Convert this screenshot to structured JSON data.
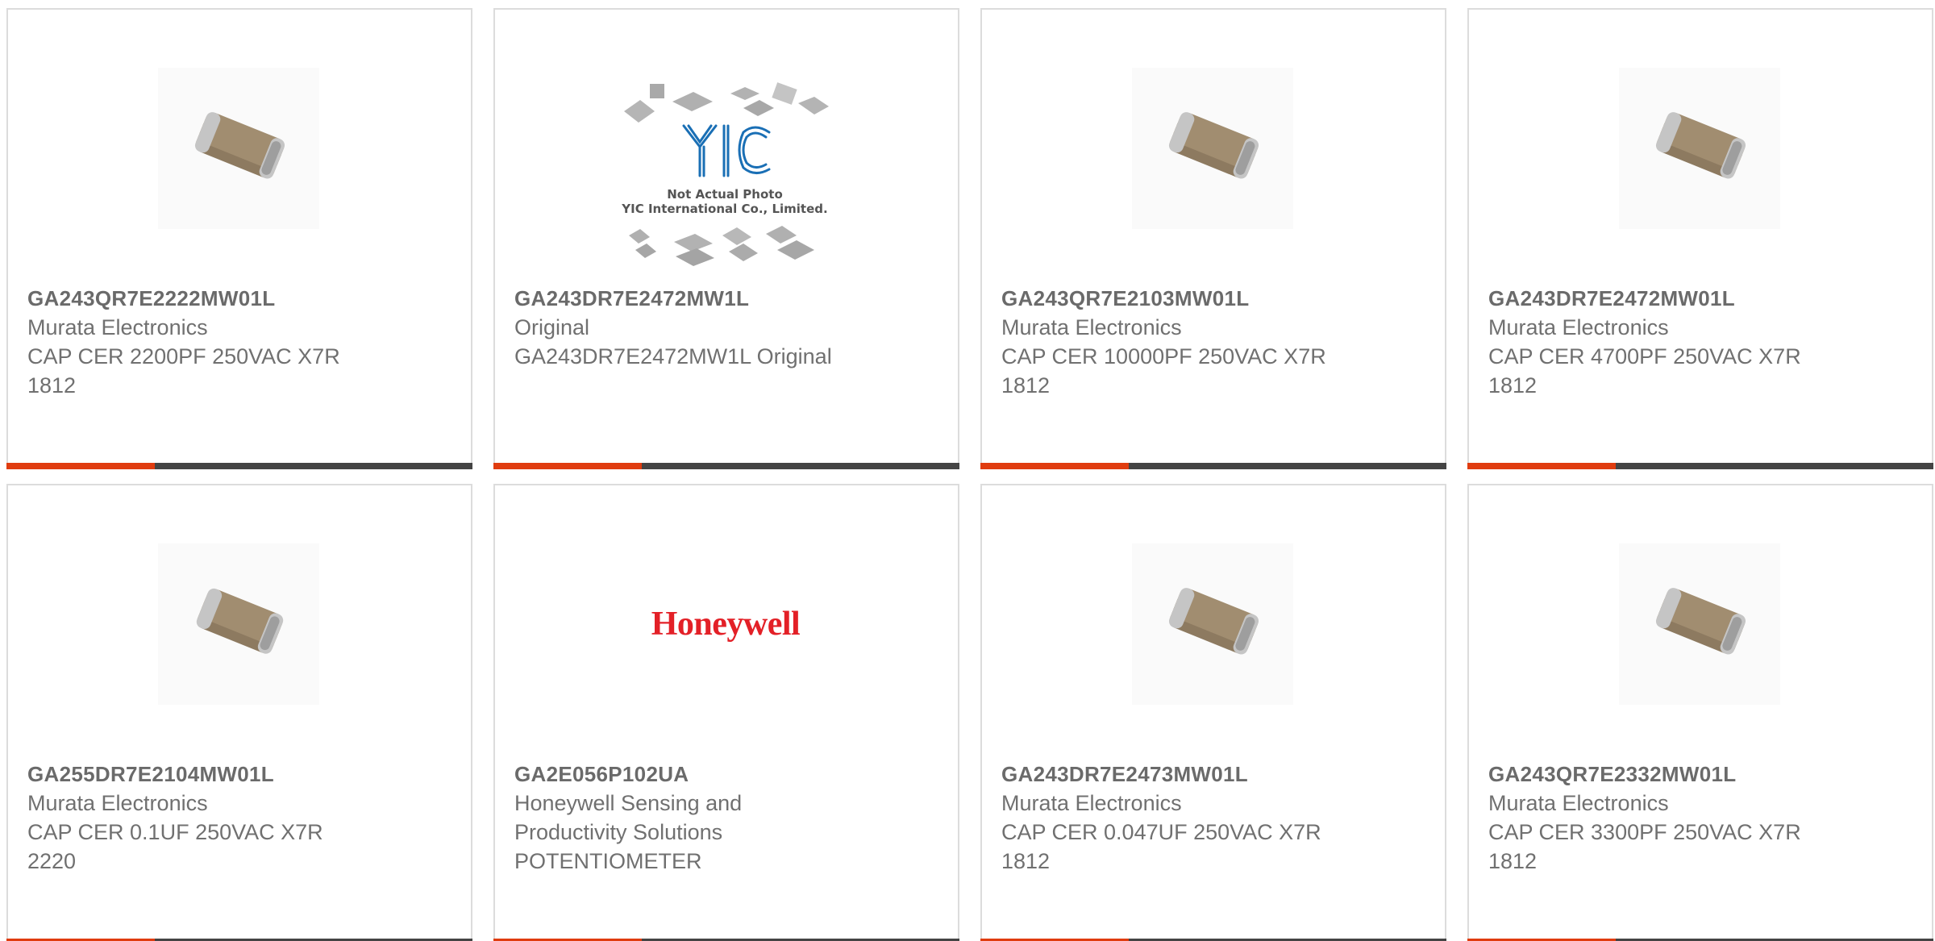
{
  "products": [
    {
      "part_number": "GA243QR7E2222MW01L",
      "manufacturer": "Murata Electronics",
      "description": "CAP CER 2200PF 250VAC X7R 1812",
      "image": "capacitor-chip"
    },
    {
      "part_number": "GA243DR7E2472MW1L",
      "manufacturer": "Original",
      "description": "GA243DR7E2472MW1L Original",
      "image": "yic-placeholder",
      "image_caption": [
        "Not Actual Photo",
        "YIC International Co., Limited."
      ],
      "image_logo": "YIC"
    },
    {
      "part_number": "GA243QR7E2103MW01L",
      "manufacturer": "Murata Electronics",
      "description": "CAP CER 10000PF 250VAC X7R 1812",
      "image": "capacitor-chip"
    },
    {
      "part_number": "GA243DR7E2472MW01L",
      "manufacturer": "Murata Electronics",
      "description": "CAP CER 4700PF 250VAC X7R 1812",
      "image": "capacitor-chip"
    },
    {
      "part_number": "GA255DR7E2104MW01L",
      "manufacturer": "Murata Electronics",
      "description": "CAP CER 0.1UF 250VAC X7R 2220",
      "image": "capacitor-chip"
    },
    {
      "part_number": "GA2E056P102UA",
      "manufacturer": "Honeywell Sensing and Productivity Solutions",
      "description": "POTENTIOMETER",
      "image": "honeywell-logo",
      "image_logo": "Honeywell"
    },
    {
      "part_number": "GA243DR7E2473MW01L",
      "manufacturer": "Murata Electronics",
      "description": "CAP CER 0.047UF 250VAC X7R 1812",
      "image": "capacitor-chip"
    },
    {
      "part_number": "GA243QR7E2332MW01L",
      "manufacturer": "Murata Electronics",
      "description": "CAP CER 3300PF 250VAC X7R 1812",
      "image": "capacitor-chip"
    }
  ],
  "colors": {
    "accent": "#e03c0f",
    "bar": "#444444",
    "honeywell_red": "#e32027",
    "yic_blue": "#1a6fb5"
  }
}
